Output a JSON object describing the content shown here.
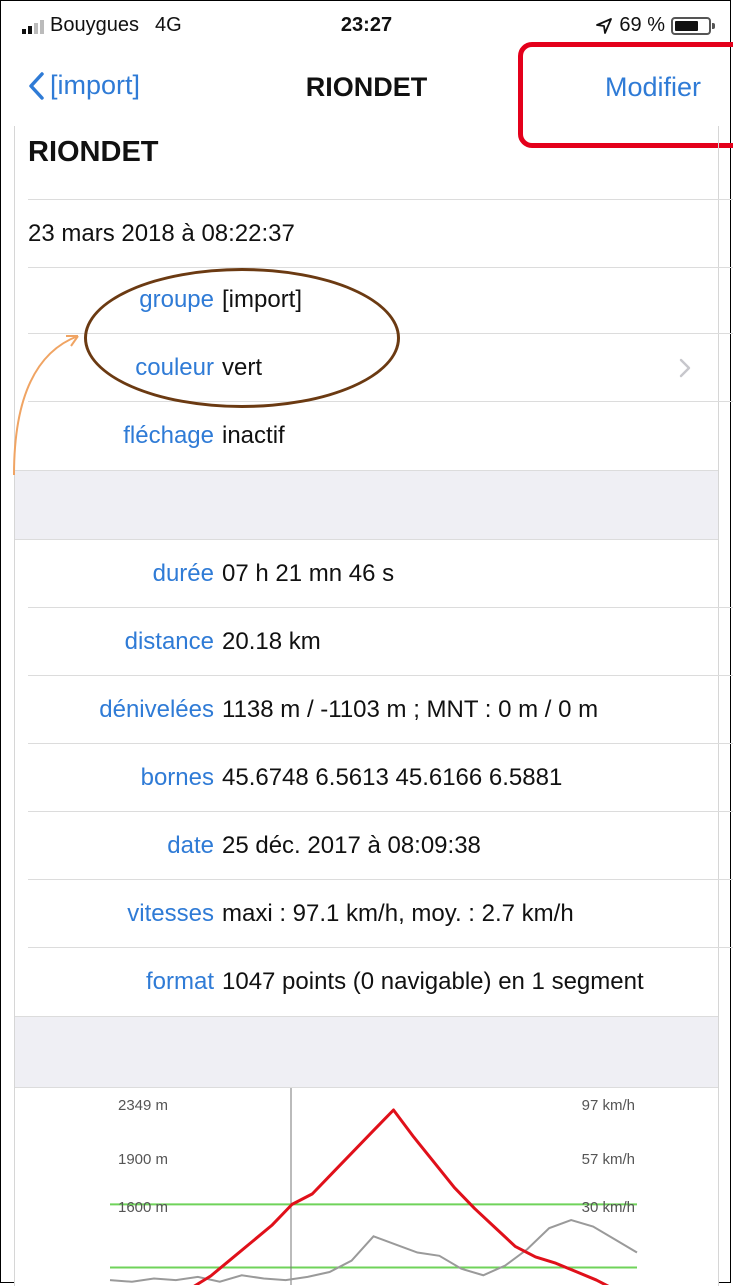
{
  "status": {
    "carrier": "Bouygues",
    "network": "4G",
    "time": "23:27",
    "battery": "69 %"
  },
  "nav": {
    "back_label": "[import]",
    "title": "RIONDET",
    "edit_label": "Modifier"
  },
  "track": {
    "name": "RIONDET",
    "created": "23 mars 2018 à 08:22:37",
    "props": [
      {
        "k": "groupe",
        "v": "[import]"
      },
      {
        "k": "couleur",
        "v": "vert"
      },
      {
        "k": "fléchage",
        "v": "inactif"
      }
    ],
    "stats": [
      {
        "k": "durée",
        "v": "07 h 21 mn 46 s"
      },
      {
        "k": "distance",
        "v": "20.18 km"
      },
      {
        "k": "dénivelées",
        "v": "1138 m / -1103 m ; MNT : 0 m / 0 m"
      },
      {
        "k": "bornes",
        "v": "45.6748 6.5613 45.6166 6.5881"
      },
      {
        "k": "date",
        "v": "25 déc. 2017 à 08:09:38"
      },
      {
        "k": "vitesses",
        "v": "maxi : 97.1 km/h, moy. : 2.7 km/h"
      },
      {
        "k": "format",
        "v": "1047 points (0 navigable) en 1 segment"
      }
    ]
  },
  "chart_data": {
    "type": "line",
    "left_ticks": [
      "2349 m",
      "1900 m",
      "1600 m"
    ],
    "right_ticks": [
      "97 km/h",
      "57 km/h",
      "30 km/h"
    ],
    "series": [
      {
        "color": "#e0101a",
        "values": [
          1350,
          1450,
          1500,
          1560,
          1640,
          1720,
          1800,
          1900,
          1950,
          2050,
          2150,
          2250,
          2349,
          2220,
          2100,
          1980,
          1880,
          1790,
          1700,
          1650,
          1620,
          1580,
          1540,
          1490,
          1420
        ]
      },
      {
        "color": "#9a9a9a",
        "values": [
          3,
          2,
          4,
          3,
          5,
          2,
          6,
          4,
          3,
          5,
          8,
          15,
          30,
          25,
          20,
          18,
          10,
          6,
          12,
          22,
          35,
          40,
          36,
          28,
          20
        ]
      }
    ],
    "guides": [
      1900,
      1600
    ],
    "ylim": [
      1350,
      2349
    ],
    "y2lim": [
      0,
      97
    ]
  }
}
